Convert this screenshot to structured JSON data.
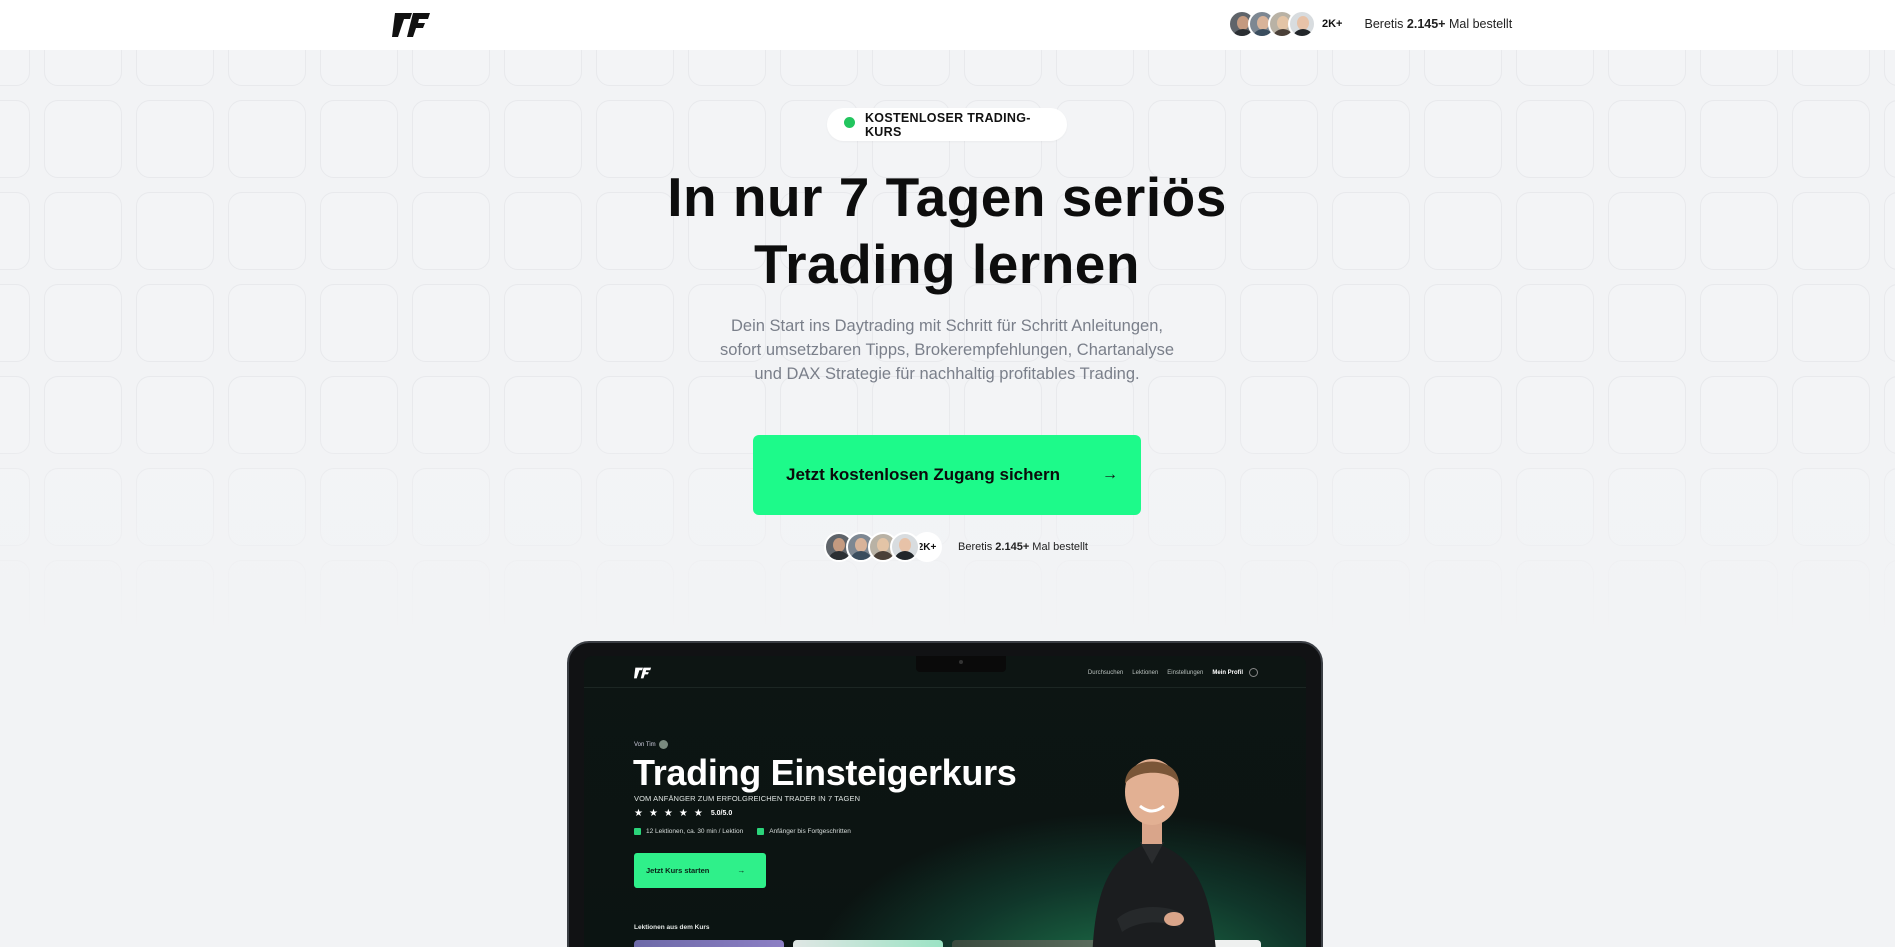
{
  "header": {
    "logo_name": "tf-logo",
    "social_count": "2K+",
    "ordered_prefix": "Beretis ",
    "ordered_number": "2.145+",
    "ordered_suffix": " Mal bestellt"
  },
  "hero": {
    "badge_label": "KOSTENLOSER TRADING-KURS",
    "headline_line1": "In nur 7 Tagen seriös",
    "headline_line2": "Trading lernen",
    "subtext_line1": "Dein Start ins Daytrading mit Schritt für Schritt Anleitungen,",
    "subtext_line2": "sofort umsetzbaren Tipps, Brokerempfehlungen, Chartanalyse",
    "subtext_line3": "und DAX Strategie für nachhaltig profitables Trading.",
    "cta_label": "Jetzt kostenlosen Zugang sichern",
    "cta_icon": "arrow-right-icon",
    "social_count": "2K+",
    "ordered_prefix": "Beretis ",
    "ordered_number": "2.145+",
    "ordered_suffix": " Mal bestellt"
  },
  "preview": {
    "nav": [
      "Durchsuchen",
      "Lektionen",
      "Einstellungen"
    ],
    "nav_profile": "Mein Profil",
    "by_label": "Von Tim",
    "course_title": "Trading Einsteigerkurs",
    "course_subtitle": "VOM ANFÄNGER ZUM ERFOLGREICHEN TRADER IN 7 TAGEN",
    "stars": "★★★★★",
    "rating": "5.0/5.0",
    "meta_lessons": "12 Lektionen, ca. 30 min / Lektion",
    "meta_level": "Anfänger bis Fortgeschritten",
    "start_button": "Jetzt Kurs starten",
    "lessons_heading": "Lektionen aus dem Kurs"
  },
  "colors": {
    "accent": "#1dfa8a",
    "live_dot": "#22c55e",
    "page_bg": "#f2f3f5"
  }
}
